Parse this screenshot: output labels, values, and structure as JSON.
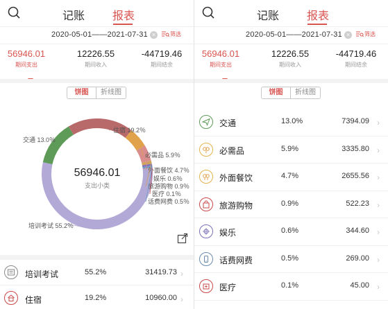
{
  "nav": {
    "tab_bookkeeping": "记账",
    "tab_reports": "报表"
  },
  "date_range": "2020-05-01——2021-07-31",
  "filter_label": "筛选",
  "summary": [
    {
      "value": "56946.01",
      "label": "期间支出"
    },
    {
      "value": "12226.55",
      "label": "期间收入"
    },
    {
      "value": "-44719.46",
      "label": "期间结余"
    }
  ],
  "chart_toggle": {
    "pie": "饼图",
    "line": "折线图"
  },
  "chart_data": {
    "type": "pie",
    "center_value": "56946.01",
    "center_label": "支出小类",
    "categories": [
      "培训考试",
      "住宿",
      "交通",
      "必需品",
      "外面餐饮",
      "旅游购物",
      "娱乐",
      "话费网费",
      "医疗"
    ],
    "percents": [
      55.2,
      19.2,
      13.0,
      5.9,
      4.7,
      0.9,
      0.6,
      0.5,
      0.1
    ],
    "labels": [
      "培训考试 55.2％",
      "住宿 19.2％",
      "交通 13.0％",
      "必需品 5.9％",
      "外面餐饮 4.7％",
      "旅游购物 0.9％",
      "娱乐 0.6％",
      "话费网费 0.5％",
      "医疗 0.1％"
    ],
    "colors": [
      "#b3a9d6",
      "#b86a6a",
      "#5e9a58",
      "#e0a24a",
      "#d98d8d",
      "#cfa35c",
      "#7c6fb8",
      "#6ea0c8",
      "#c05656"
    ]
  },
  "left_list": [
    {
      "icon": "book-icon",
      "name": "培训考试",
      "percent": "55.2%",
      "amount": "31419.73"
    },
    {
      "icon": "house-icon",
      "name": "住宿",
      "percent": "19.2%",
      "amount": "10960.00"
    }
  ],
  "right_list": [
    {
      "icon": "plane-icon",
      "name": "交通",
      "percent": "13.0%",
      "amount": "7394.09"
    },
    {
      "icon": "necessities-icon",
      "name": "必需品",
      "percent": "5.9%",
      "amount": "3335.80"
    },
    {
      "icon": "dining-icon",
      "name": "外面餐饮",
      "percent": "4.7%",
      "amount": "2655.56"
    },
    {
      "icon": "shopping-bag-icon",
      "name": "旅游购物",
      "percent": "0.9%",
      "amount": "522.23"
    },
    {
      "icon": "entertainment-icon",
      "name": "娱乐",
      "percent": "0.6%",
      "amount": "344.60"
    },
    {
      "icon": "phone-icon",
      "name": "话费网费",
      "percent": "0.5%",
      "amount": "269.00"
    },
    {
      "icon": "medical-icon",
      "name": "医疗",
      "percent": "0.1%",
      "amount": "45.00"
    }
  ]
}
